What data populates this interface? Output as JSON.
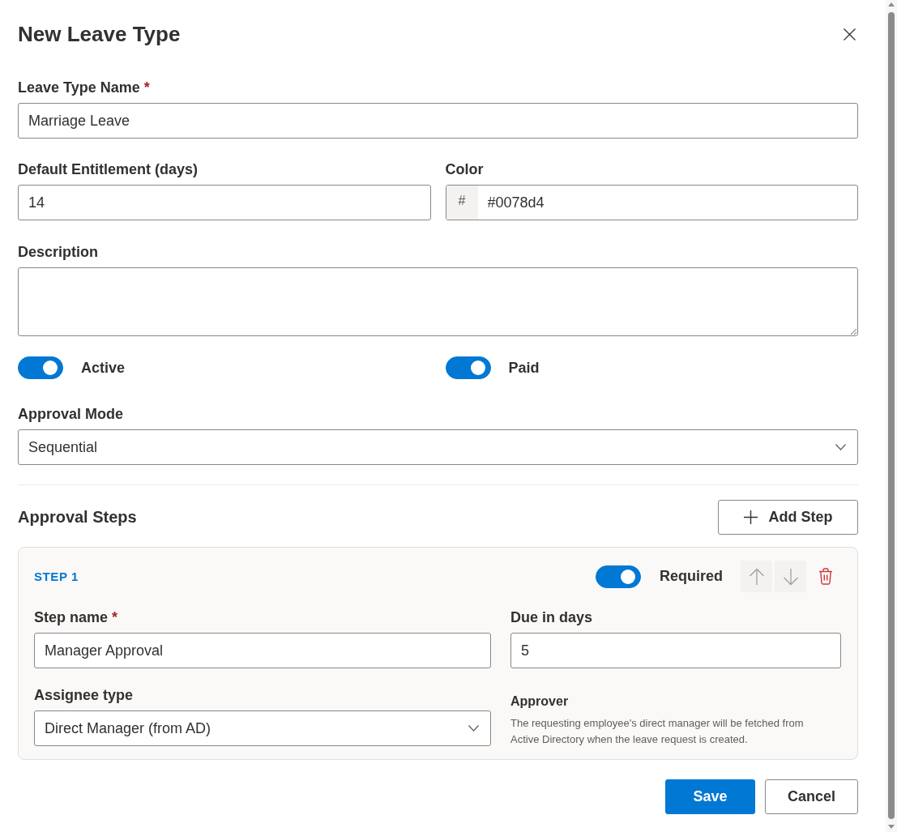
{
  "title": "New Leave Type",
  "leave_type_name": {
    "label": "Leave Type Name",
    "required_mark": "*",
    "value": "Marriage Leave"
  },
  "default_entitlement": {
    "label": "Default Entitlement (days)",
    "value": "14"
  },
  "color": {
    "label": "Color",
    "prefix": "#",
    "value": "#0078d4"
  },
  "description": {
    "label": "Description"
  },
  "toggles": [
    {
      "label": "Active",
      "on": true
    },
    {
      "label": "Paid",
      "on": true
    }
  ],
  "approval_mode": {
    "label": "Approval Mode",
    "value": "Sequential"
  },
  "approval_steps": {
    "heading": "Approval Steps",
    "add_button": "Add Step",
    "steps": [
      {
        "title": "STEP 1",
        "required": {
          "label": "Required",
          "on": true
        },
        "reorder_buttons": [
          {
            "kind": "up",
            "disabled": true
          },
          {
            "kind": "down",
            "disabled": true
          }
        ],
        "step_name": {
          "label": "Step name",
          "required_mark": "*",
          "value": "Manager Approval"
        },
        "due_in_days": {
          "label": "Due in days",
          "value": "5"
        },
        "assignee_type": {
          "label": "Assignee type",
          "value": "Direct Manager (from AD)"
        },
        "approver": {
          "heading": "Approver",
          "note": "The requesting employee's direct manager will be fetched from Active Directory when the leave request is created."
        }
      }
    ]
  },
  "buttons": [
    {
      "kind": "primary",
      "label": "Save"
    },
    {
      "kind": "secondary",
      "label": "Cancel"
    }
  ]
}
